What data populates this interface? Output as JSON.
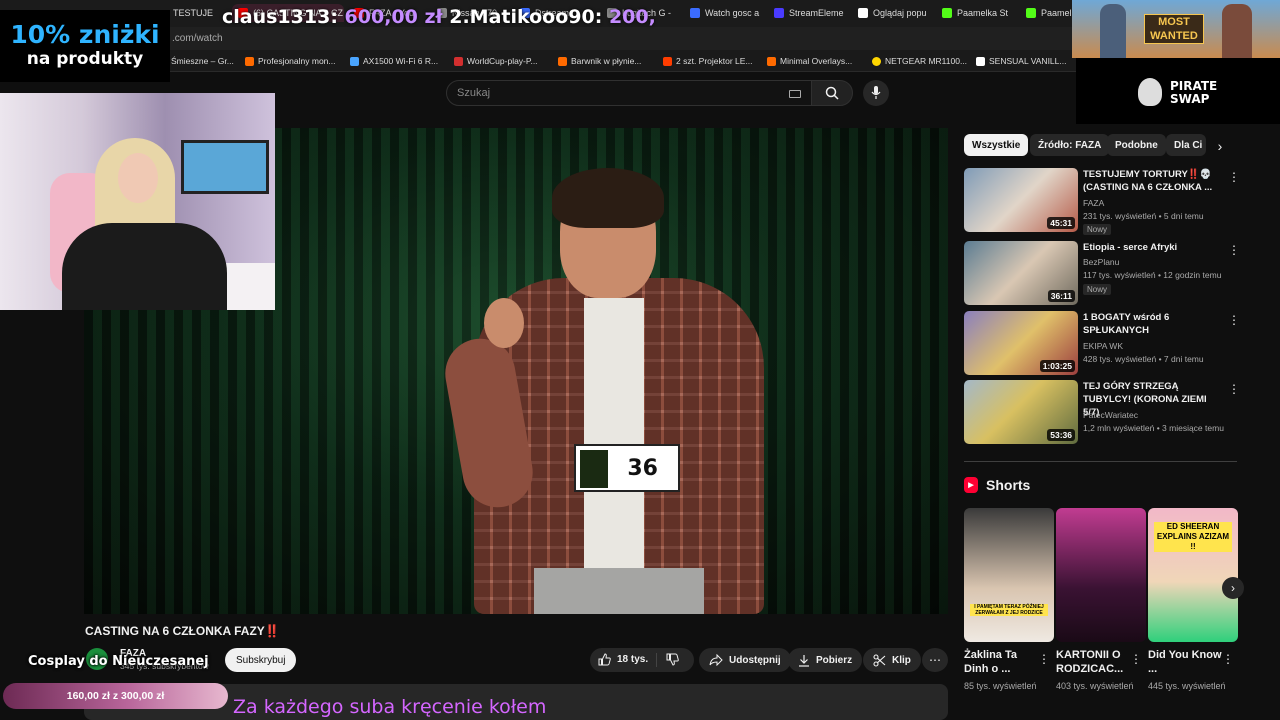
{
  "browser": {
    "tabs": [
      {
        "label": "TESTUJE",
        "color": "#ff0000"
      },
      {
        "label": "(6) CASTING NA 6 CZ",
        "color": "#ff0000",
        "active": true
      },
      {
        "label": "FAZA - You",
        "color": "#ff0000"
      },
      {
        "label": "Nissan 370",
        "color": "#888888"
      },
      {
        "label": "Dstream",
        "color": "#3b6cff"
      },
      {
        "label": "Logitech G -",
        "color": "#888888"
      },
      {
        "label": "Watch gosc a",
        "color": "#3b6cff"
      },
      {
        "label": "StreamEleme",
        "color": "#4a3bff"
      },
      {
        "label": "Oglądaj popu",
        "color": "#ffffff"
      },
      {
        "label": "Paamelka St",
        "color": "#53fc18"
      },
      {
        "label": "Paamelk",
        "color": "#53fc18"
      }
    ],
    "url": ".com/watch",
    "bookmarks": [
      {
        "label": "Śmieszne – Gr...",
        "color": "#888888"
      },
      {
        "label": "Profesjonalny mon...",
        "color": "#ff6a00"
      },
      {
        "label": "AX1500 Wi-Fi 6 R...",
        "color": "#4aa5ff"
      },
      {
        "label": "WorldCup-play-P...",
        "color": "#d32f2f"
      },
      {
        "label": "Barwnik w płynie...",
        "color": "#ff6a00"
      },
      {
        "label": "2 szt. Projektor LE...",
        "color": "#ff3d00"
      },
      {
        "label": "Minimal Overlays...",
        "color": "#ff6a00"
      },
      {
        "label": "NETGEAR MR1100...",
        "color": "#ffd600"
      },
      {
        "label": "SENSUAL VANILL...",
        "color": "#ffffff"
      }
    ]
  },
  "search": {
    "placeholder": "Szukaj"
  },
  "overlay": {
    "promo_line1": "10% zniżki",
    "promo_line2": "na produkty",
    "donor1_name": "claus1313:",
    "donor1_amount": "600,00 zł",
    "donor2_name": "2.Matikooo90:",
    "donor2_amount": "200,",
    "ad_sign": "MOST WANTED",
    "ad_brand_line1": "PIRATE",
    "ad_brand_line2": "SWAP",
    "cosplay_text": "Cosplay do Nieuczesanej",
    "goal_current": "160,00 zł",
    "goal_sep": "z",
    "goal_target": "300,00 zł",
    "ticker": "Za każdego suba kręcenie kołem"
  },
  "video": {
    "bib_number": "36",
    "title": "CASTING NA 6 CZŁONKA FAZY‼️",
    "channel": "FAZA",
    "subscribers": "345 tys. subskrybentów",
    "subscribe_label": "Subskrybuj",
    "likes": "18 tys.",
    "share_label": "Udostępnij",
    "download_label": "Pobierz",
    "clip_label": "Klip"
  },
  "chips": [
    "Wszystkie",
    "Źródło: FAZA",
    "Podobne",
    "Dla Ci"
  ],
  "related": [
    {
      "title": "TESTUJEMY TORTURY‼️💀 (CASTING NA 6 CZŁONKA ...",
      "channel": "FAZA",
      "meta": "231 tys. wyświetleń • 5 dni temu",
      "badge": "Nowy",
      "duration": "45:31"
    },
    {
      "title": "Etiopia - serce Afryki",
      "channel": "BezPlanu",
      "meta": "117 tys. wyświetleń • 12 godzin temu",
      "badge": "Nowy",
      "duration": "36:11"
    },
    {
      "title": "1 BOGATY wśród 6 SPŁUKANYCH",
      "channel": "EKIPA WK",
      "meta": "428 tys. wyświetleń • 7 dni temu",
      "badge": "",
      "duration": "1:03:25"
    },
    {
      "title": "TEJ GÓRY STRZEGĄ TUBYLCY! (KORONA ZIEMI 5/7)",
      "channel": "PatecWariatec",
      "meta": "1,2 mln wyświetleń • 3 miesiące temu",
      "badge": "",
      "duration": "53:36"
    }
  ],
  "shorts": {
    "heading": "Shorts",
    "items": [
      {
        "title": "Żaklina Ta Dinh o ...",
        "views": "85 tys. wyświetleń",
        "thumb_text": "I PAMIĘTAM TERAZ PÓŹNIEJ ZERWAŁAM Z JEJ RODZICE"
      },
      {
        "title": "KARTONII O RODZICAC...",
        "views": "403 tys. wyświetleń",
        "thumb_text": ""
      },
      {
        "title": "Did You Know ...",
        "views": "445 tys. wyświetleń",
        "thumb_text": "ED SHEERAN EXPLAINS AZIZAM !!"
      }
    ]
  }
}
